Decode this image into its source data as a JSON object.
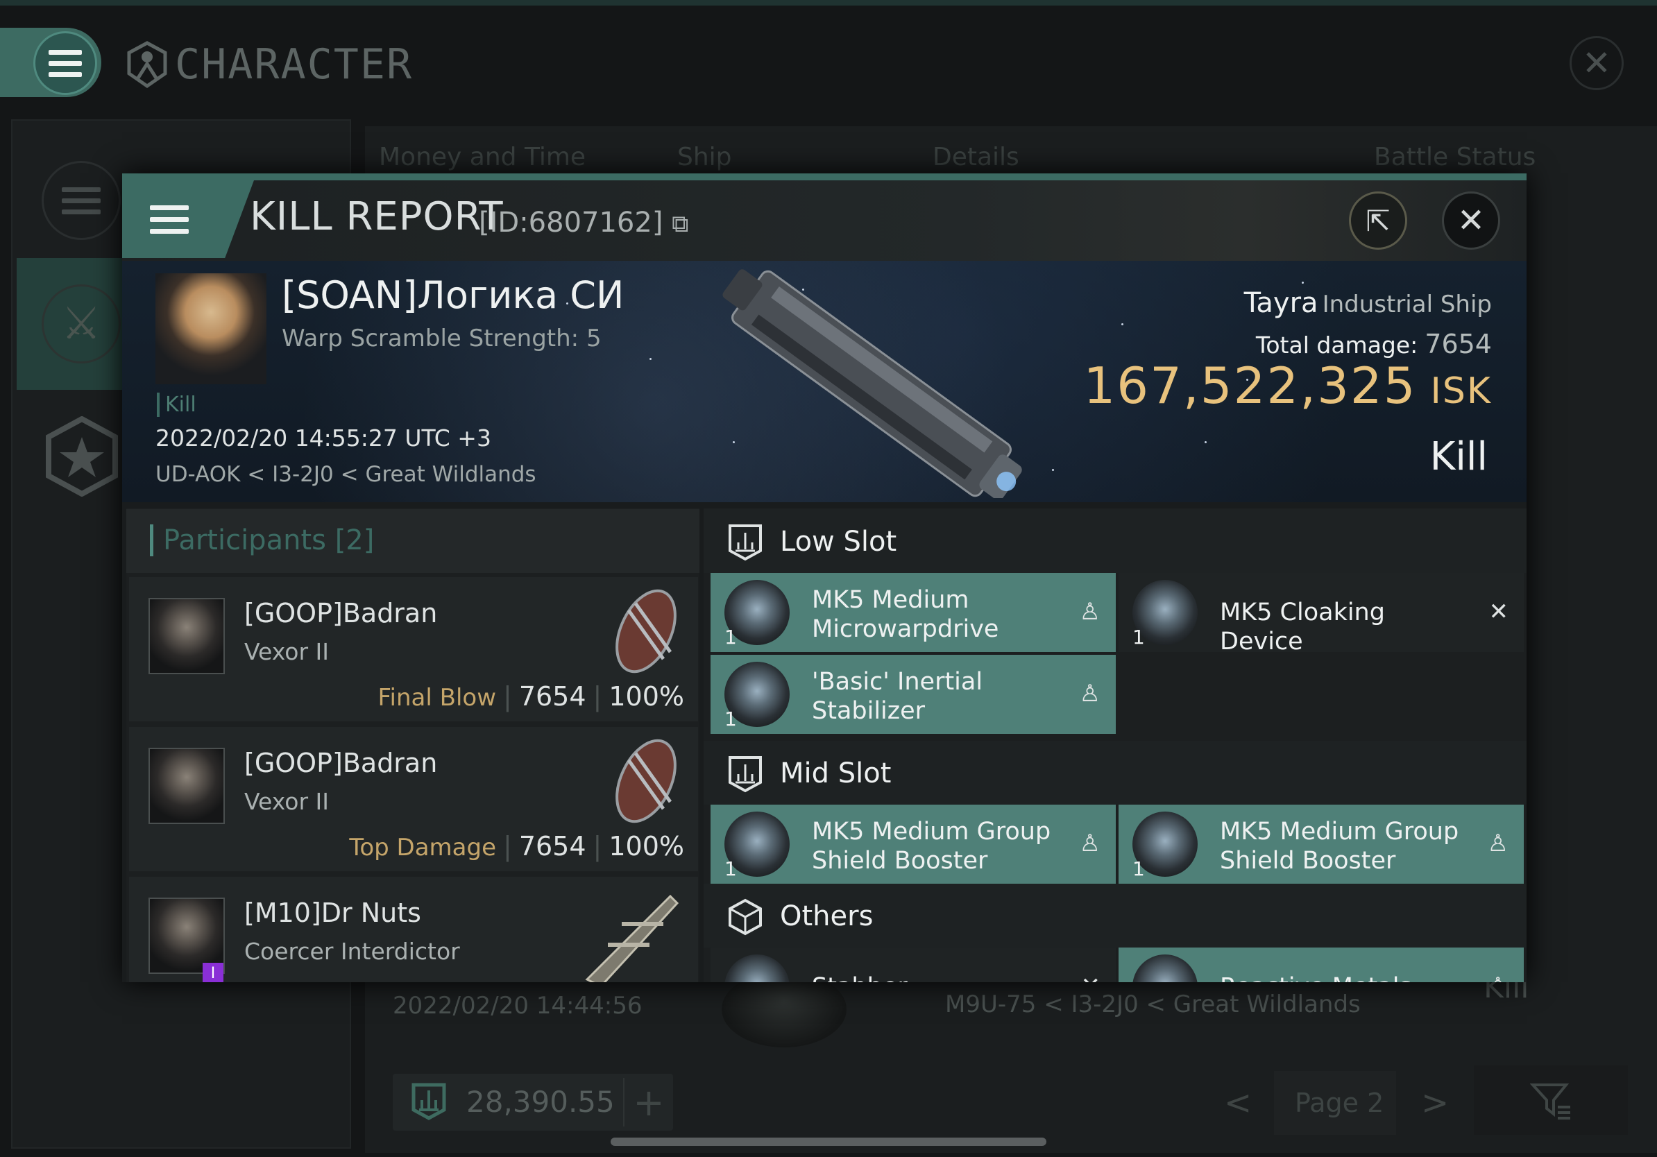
{
  "colors": {
    "accent": "#3c6b63",
    "isk": "#e8c27d",
    "bg": "#141617"
  },
  "window": {
    "title": "CHARACTER",
    "close_icon": "close-icon",
    "menu_icon": "menu-icon"
  },
  "columns": [
    "Money and Time",
    "Ship",
    "Details",
    "Battle Status"
  ],
  "background_row": {
    "date": "2022/02/20 14:44:56",
    "location": "M9U-75 < I3-2J0 < Great Wildlands",
    "status": "Kill"
  },
  "footer": {
    "wallet": "28,390.55",
    "plus": "+",
    "prev": "<",
    "page": "Page 2",
    "next": ">"
  },
  "kill_report": {
    "title": "KILL REPORT",
    "id": "[ID:6807162]",
    "victim": {
      "name": "[SOAN]Логика СИ",
      "warp": "Warp Scramble Strength: 5",
      "tag": "Kill",
      "time": "2022/02/20 14:55:27 UTC +3",
      "location": "UD-AOK < I3-2J0 < Great Wildlands"
    },
    "ship": {
      "name": "Tayra",
      "class": "Industrial Ship",
      "damage_label": "Total damage:",
      "damage": "7654",
      "isk": "167,522,325",
      "isk_unit": "ISK",
      "status": "Kill"
    },
    "participants": {
      "label": "Participants",
      "count": "[2]",
      "rows": [
        {
          "name": "[GOOP]Badran",
          "ship": "Vexor II",
          "label": "Final Blow",
          "damage": "7654",
          "pct": "100%"
        },
        {
          "name": "[GOOP]Badran",
          "ship": "Vexor II",
          "label": "Top Damage",
          "damage": "7654",
          "pct": "100%"
        },
        {
          "name": "[M10]Dr Nuts",
          "ship": "Coercer Interdictor",
          "badge": "I"
        }
      ]
    },
    "sections": {
      "low": "Low Slot",
      "mid": "Mid Slot",
      "others": "Others"
    },
    "items": [
      {
        "name": "MK5 Medium Microwarpdrive",
        "qty": "1",
        "state": "dropped"
      },
      {
        "name": "MK5 Cloaking Device",
        "qty": "1",
        "state": "destroyed"
      },
      {
        "name": "'Basic' Inertial Stabilizer",
        "qty": "1",
        "state": "dropped"
      },
      {
        "name": "MK5 Medium Group Shield Booster",
        "qty": "1",
        "state": "dropped"
      },
      {
        "name": "MK5 Medium Group Shield Booster",
        "qty": "1",
        "state": "dropped"
      },
      {
        "name": "Stabber",
        "qty": "",
        "state": "destroyed"
      },
      {
        "name": "Reactive Metals",
        "qty": "",
        "state": "dropped"
      }
    ]
  }
}
